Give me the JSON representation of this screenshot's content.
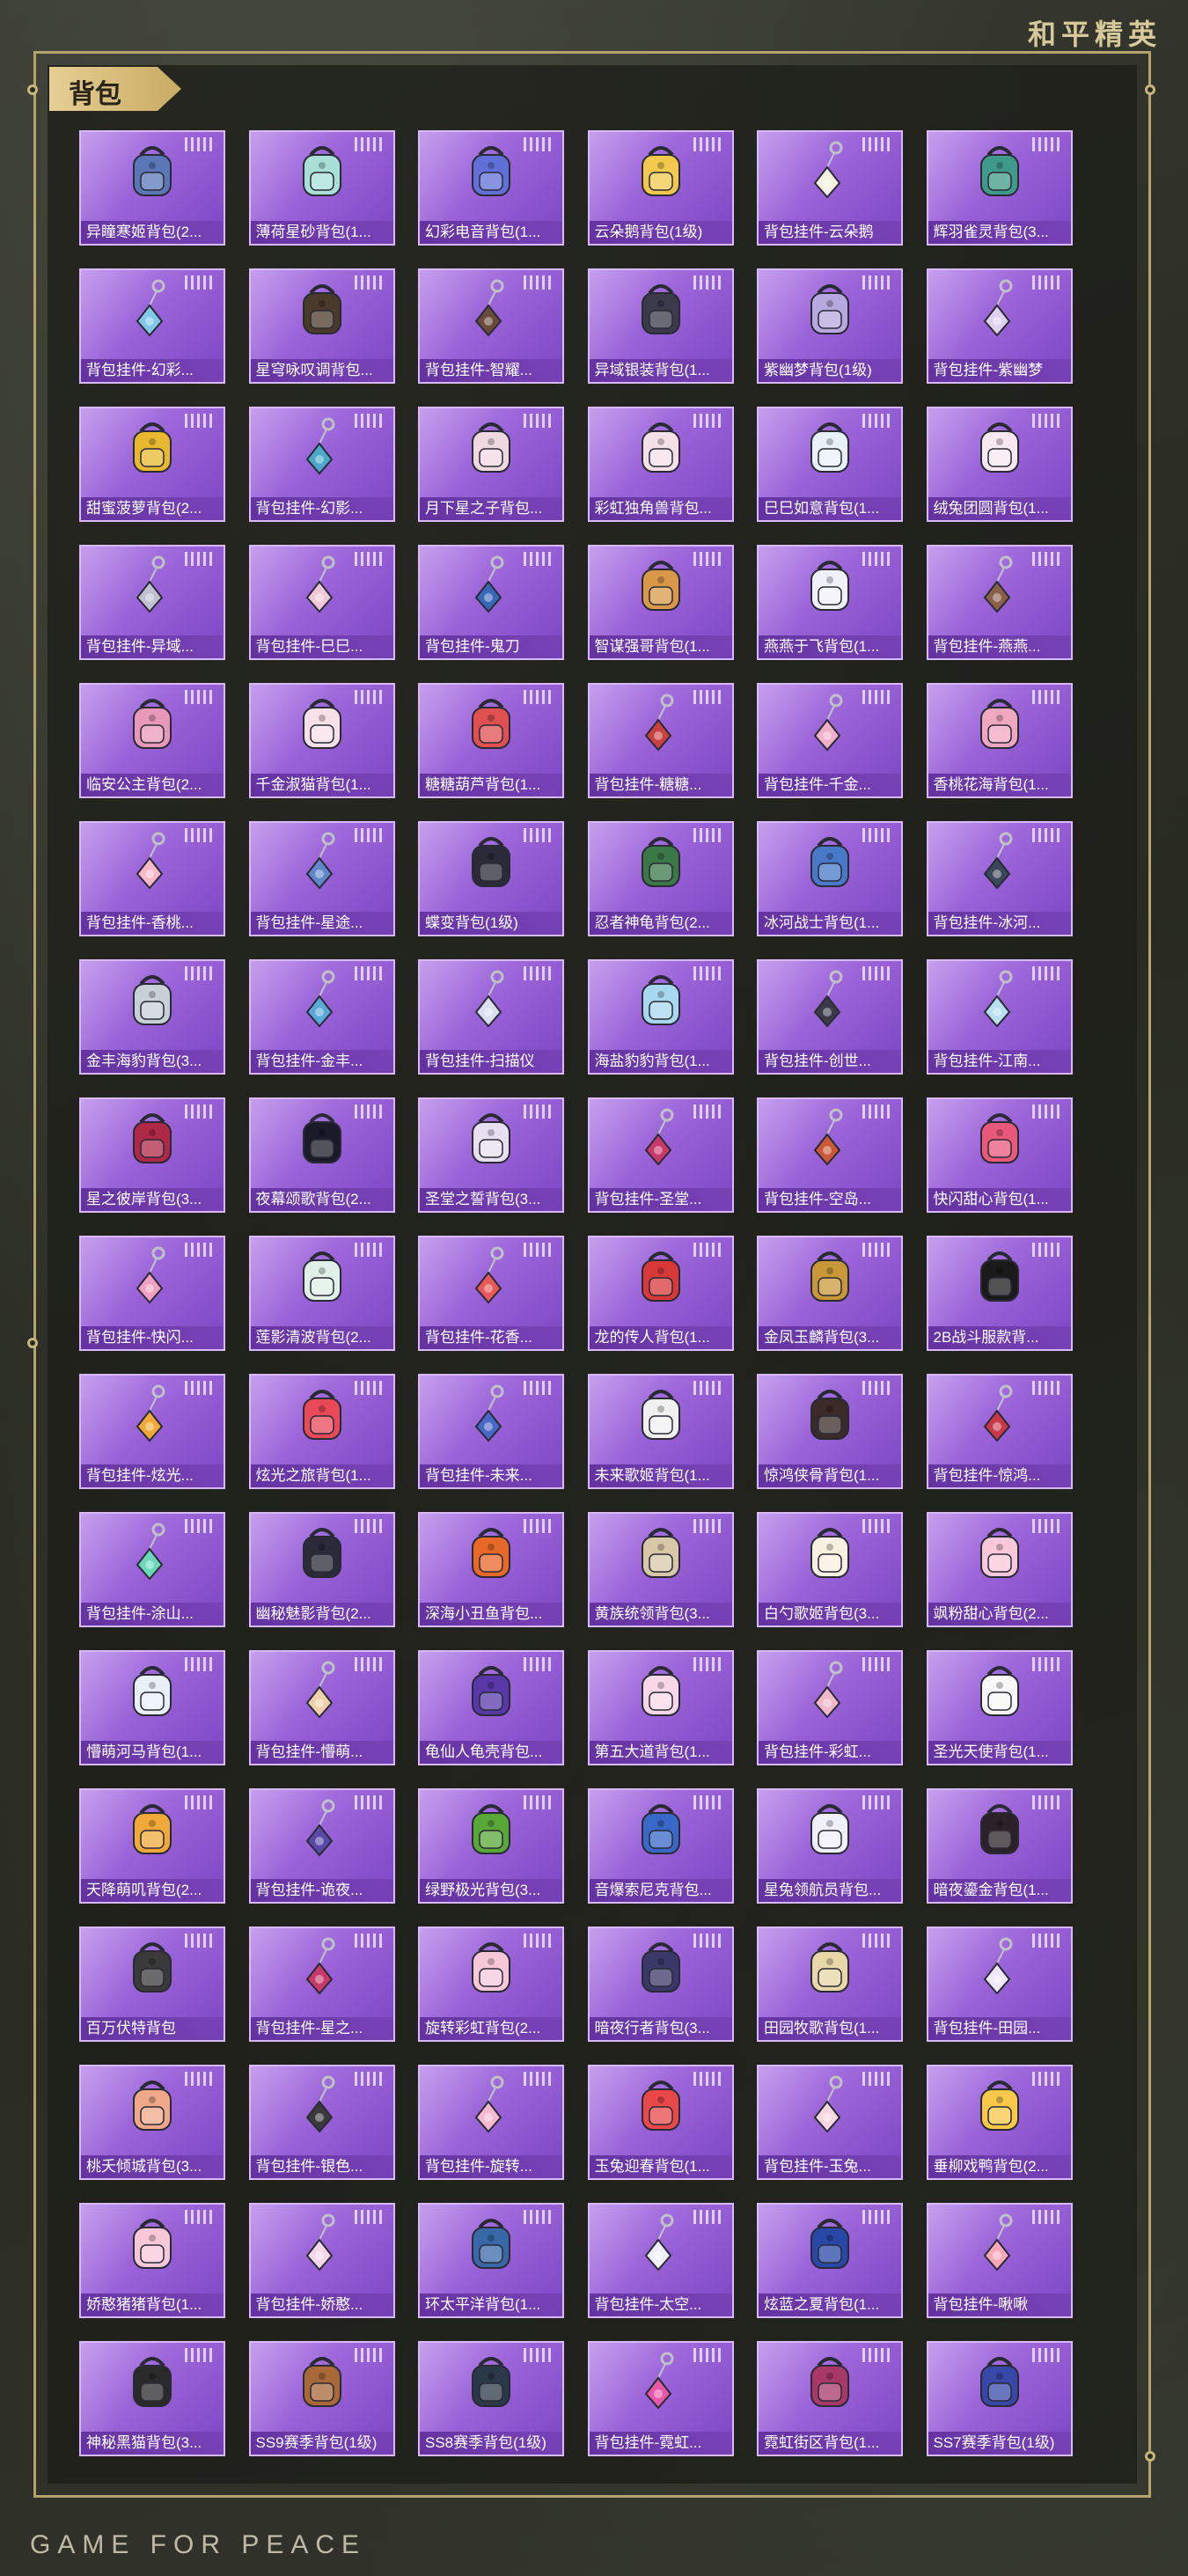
{
  "brand_top": "和平精英",
  "brand_bottom": "GAME FOR PEACE",
  "section": {
    "title": "背包"
  },
  "items": [
    {
      "name": "异瞳寒姬背包(2...",
      "icon": "backpack-icon",
      "color": "#5a78b8"
    },
    {
      "name": "薄荷星砂背包(1...",
      "icon": "backpack-icon",
      "color": "#a8e0d8"
    },
    {
      "name": "幻彩电音背包(1...",
      "icon": "backpack-icon",
      "color": "#6070d8"
    },
    {
      "name": "云朵鹅背包(1级)",
      "icon": "backpack-icon",
      "color": "#f2c94c"
    },
    {
      "name": "背包挂件-云朵鹅",
      "icon": "pendant-icon",
      "color": "#f5f0e0"
    },
    {
      "name": "辉羽雀灵背包(3...",
      "icon": "backpack-icon",
      "color": "#3f9a8a"
    },
    {
      "name": "背包挂件-幻彩...",
      "icon": "pendant-icon",
      "color": "#7fc8e8"
    },
    {
      "name": "星穹咏叹调背包...",
      "icon": "backpack-icon",
      "color": "#4a3a2a"
    },
    {
      "name": "背包挂件-智耀...",
      "icon": "pendant-icon",
      "color": "#6a4a3a"
    },
    {
      "name": "异域银装背包(1...",
      "icon": "backpack-icon",
      "color": "#3a3a4a"
    },
    {
      "name": "紫幽梦背包(1级)",
      "icon": "backpack-icon",
      "color": "#b8a8e0"
    },
    {
      "name": "背包挂件-紫幽梦",
      "icon": "pendant-icon",
      "color": "#e0d0f0"
    },
    {
      "name": "甜蜜菠萝背包(2...",
      "icon": "backpack-icon",
      "color": "#e8b830"
    },
    {
      "name": "背包挂件-幻影...",
      "icon": "pendant-icon",
      "color": "#4aa8c8"
    },
    {
      "name": "月下星之子背包...",
      "icon": "backpack-icon",
      "color": "#f0d8e0"
    },
    {
      "name": "彩虹独角兽背包...",
      "icon": "backpack-icon",
      "color": "#f5e0e8"
    },
    {
      "name": "巳巳如意背包(1...",
      "icon": "backpack-icon",
      "color": "#e8f0f8"
    },
    {
      "name": "绒兔团圆背包(1...",
      "icon": "backpack-icon",
      "color": "#f8e8f0"
    },
    {
      "name": "背包挂件-异域...",
      "icon": "pendant-icon",
      "color": "#c0c0d0"
    },
    {
      "name": "背包挂件-巳巳...",
      "icon": "pendant-icon",
      "color": "#f0c8d8"
    },
    {
      "name": "背包挂件-鬼刀",
      "icon": "pendant-icon",
      "color": "#3a68b8"
    },
    {
      "name": "智谋强哥背包(1...",
      "icon": "backpack-icon",
      "color": "#d89848"
    },
    {
      "name": "燕燕于飞背包(1...",
      "icon": "backpack-icon",
      "color": "#f0f0f8"
    },
    {
      "name": "背包挂件-燕燕...",
      "icon": "pendant-icon",
      "color": "#8a6048"
    },
    {
      "name": "临安公主背包(2...",
      "icon": "backpack-icon",
      "color": "#e898b8"
    },
    {
      "name": "千金淑猫背包(1...",
      "icon": "backpack-icon",
      "color": "#f8e0e8"
    },
    {
      "name": "糖糖葫芦背包(1...",
      "icon": "backpack-icon",
      "color": "#e05050"
    },
    {
      "name": "背包挂件-糖糖...",
      "icon": "pendant-icon",
      "color": "#c84040"
    },
    {
      "name": "背包挂件-千金...",
      "icon": "pendant-icon",
      "color": "#f0b0c8"
    },
    {
      "name": "香桃花海背包(1...",
      "icon": "backpack-icon",
      "color": "#f0a8c0"
    },
    {
      "name": "背包挂件-香桃...",
      "icon": "pendant-icon",
      "color": "#f8b8c8"
    },
    {
      "name": "背包挂件-星途...",
      "icon": "pendant-icon",
      "color": "#6088c8"
    },
    {
      "name": "蝶变背包(1级)",
      "icon": "backpack-icon",
      "color": "#2a2a38"
    },
    {
      "name": "忍者神龟背包(2...",
      "icon": "backpack-icon",
      "color": "#3a7848"
    },
    {
      "name": "冰河战士背包(1...",
      "icon": "backpack-icon",
      "color": "#4878c8"
    },
    {
      "name": "背包挂件-冰河...",
      "icon": "pendant-icon",
      "color": "#3a4858"
    },
    {
      "name": "金丰海豹背包(3...",
      "icon": "backpack-icon",
      "color": "#c8d0d8"
    },
    {
      "name": "背包挂件-金丰...",
      "icon": "pendant-icon",
      "color": "#58a8d8"
    },
    {
      "name": "背包挂件-扫描仪",
      "icon": "pendant-icon",
      "color": "#d8e0f0"
    },
    {
      "name": "海盐豹豹背包(1...",
      "icon": "backpack-icon",
      "color": "#a8d8f0"
    },
    {
      "name": "背包挂件-创世...",
      "icon": "pendant-icon",
      "color": "#3a3a48"
    },
    {
      "name": "背包挂件-江南...",
      "icon": "pendant-icon",
      "color": "#b8e0f0"
    },
    {
      "name": "星之彼岸背包(3...",
      "icon": "backpack-icon",
      "color": "#b02848"
    },
    {
      "name": "夜幕颂歌背包(2...",
      "icon": "backpack-icon",
      "color": "#1a1a28"
    },
    {
      "name": "圣堂之誓背包(3...",
      "icon": "backpack-icon",
      "color": "#e8e0f0"
    },
    {
      "name": "背包挂件-圣堂...",
      "icon": "pendant-icon",
      "color": "#c83868"
    },
    {
      "name": "背包挂件-空岛...",
      "icon": "pendant-icon",
      "color": "#c85838"
    },
    {
      "name": "快闪甜心背包(1...",
      "icon": "backpack-icon",
      "color": "#e85878"
    },
    {
      "name": "背包挂件-快闪...",
      "icon": "pendant-icon",
      "color": "#f0a0c0"
    },
    {
      "name": "莲影清波背包(2...",
      "icon": "backpack-icon",
      "color": "#e0f0e8"
    },
    {
      "name": "背包挂件-花香...",
      "icon": "pendant-icon",
      "color": "#e85858"
    },
    {
      "name": "龙的传人背包(1...",
      "icon": "backpack-icon",
      "color": "#d83838"
    },
    {
      "name": "金凤玉麟背包(3...",
      "icon": "backpack-icon",
      "color": "#c89838"
    },
    {
      "name": "2B战斗服款背...",
      "icon": "backpack-icon",
      "color": "#1a1a1a"
    },
    {
      "name": "背包挂件-炫光...",
      "icon": "pendant-icon",
      "color": "#f0a838"
    },
    {
      "name": "炫光之旅背包(1...",
      "icon": "backpack-icon",
      "color": "#e84858"
    },
    {
      "name": "背包挂件-未来...",
      "icon": "pendant-icon",
      "color": "#4868c8"
    },
    {
      "name": "未来歌姬背包(1...",
      "icon": "backpack-icon",
      "color": "#f0f0f0"
    },
    {
      "name": "惊鸿侠骨背包(1...",
      "icon": "backpack-icon",
      "color": "#3a2a28"
    },
    {
      "name": "背包挂件-惊鸿...",
      "icon": "pendant-icon",
      "color": "#c83848"
    },
    {
      "name": "背包挂件-涂山...",
      "icon": "pendant-icon",
      "color": "#68d8b8"
    },
    {
      "name": "幽秘魅影背包(2...",
      "icon": "backpack-icon",
      "color": "#2a2a38"
    },
    {
      "name": "深海小丑鱼背包...",
      "icon": "backpack-icon",
      "color": "#e86828"
    },
    {
      "name": "黄族统领背包(3...",
      "icon": "backpack-icon",
      "color": "#d8c8a8"
    },
    {
      "name": "白勺歌姬背包(3...",
      "icon": "backpack-icon",
      "color": "#f8f0e0"
    },
    {
      "name": "飒粉甜心背包(2...",
      "icon": "backpack-icon",
      "color": "#f8c8d8"
    },
    {
      "name": "懵萌河马背包(1...",
      "icon": "backpack-icon",
      "color": "#e8f0f8"
    },
    {
      "name": "背包挂件-懵萌...",
      "icon": "pendant-icon",
      "color": "#f0d0a8"
    },
    {
      "name": "龟仙人龟壳背包...",
      "icon": "backpack-icon",
      "color": "#5838a8"
    },
    {
      "name": "第五大道背包(1...",
      "icon": "backpack-icon",
      "color": "#f8d8e8"
    },
    {
      "name": "背包挂件-彩虹...",
      "icon": "pendant-icon",
      "color": "#f0b8c8"
    },
    {
      "name": "圣光天使背包(1...",
      "icon": "backpack-icon",
      "color": "#f8f8f8"
    },
    {
      "name": "天降萌叽背包(2...",
      "icon": "backpack-icon",
      "color": "#f0a838"
    },
    {
      "name": "背包挂件-诡夜...",
      "icon": "pendant-icon",
      "color": "#5848a8"
    },
    {
      "name": "绿野极光背包(3...",
      "icon": "backpack-icon",
      "color": "#58a838"
    },
    {
      "name": "音爆索尼克背包...",
      "icon": "backpack-icon",
      "color": "#3868c8"
    },
    {
      "name": "星兔领航员背包...",
      "icon": "backpack-icon",
      "color": "#f0f0f8"
    },
    {
      "name": "暗夜鎏金背包(1...",
      "icon": "backpack-icon",
      "color": "#2a2228"
    },
    {
      "name": "百万伏特背包",
      "icon": "backpack-icon",
      "color": "#3a3a3a"
    },
    {
      "name": "背包挂件-星之...",
      "icon": "pendant-icon",
      "color": "#c83868"
    },
    {
      "name": "旋转彩虹背包(2...",
      "icon": "backpack-icon",
      "color": "#f8c8d8"
    },
    {
      "name": "暗夜行者背包(3...",
      "icon": "backpack-icon",
      "color": "#3a3868"
    },
    {
      "name": "田园牧歌背包(1...",
      "icon": "backpack-icon",
      "color": "#e8d8a8"
    },
    {
      "name": "背包挂件-田园...",
      "icon": "pendant-icon",
      "color": "#f0e8f8"
    },
    {
      "name": "桃夭倾城背包(3...",
      "icon": "backpack-icon",
      "color": "#f0a888"
    },
    {
      "name": "背包挂件-银色...",
      "icon": "pendant-icon",
      "color": "#3a3a3a"
    },
    {
      "name": "背包挂件-旋转...",
      "icon": "pendant-icon",
      "color": "#f8b8d0"
    },
    {
      "name": "玉兔迎春背包(1...",
      "icon": "backpack-icon",
      "color": "#e84848"
    },
    {
      "name": "背包挂件-玉兔...",
      "icon": "pendant-icon",
      "color": "#f8d8e0"
    },
    {
      "name": "垂柳戏鸭背包(2...",
      "icon": "backpack-icon",
      "color": "#f8c848"
    },
    {
      "name": "娇憨猪猪背包(1...",
      "icon": "backpack-icon",
      "color": "#f8c8d8"
    },
    {
      "name": "背包挂件-娇憨...",
      "icon": "pendant-icon",
      "color": "#f8d8e8"
    },
    {
      "name": "环太平洋背包(1...",
      "icon": "backpack-icon",
      "color": "#3868a8"
    },
    {
      "name": "背包挂件-太空...",
      "icon": "pendant-icon",
      "color": "#f0f0f8"
    },
    {
      "name": "炫蓝之夏背包(1...",
      "icon": "backpack-icon",
      "color": "#2848a8"
    },
    {
      "name": "背包挂件-啾啾",
      "icon": "pendant-icon",
      "color": "#f8a8b8"
    },
    {
      "name": "神秘黑猫背包(3...",
      "icon": "backpack-icon",
      "color": "#2a2a2a"
    },
    {
      "name": "SS9赛季背包(1级)",
      "icon": "backpack-icon",
      "color": "#a86838"
    },
    {
      "name": "SS8赛季背包(1级)",
      "icon": "backpack-icon",
      "color": "#2a3848"
    },
    {
      "name": "背包挂件-霓虹...",
      "icon": "pendant-icon",
      "color": "#e858a8"
    },
    {
      "name": "霓虹街区背包(1...",
      "icon": "backpack-icon",
      "color": "#a83868"
    },
    {
      "name": "SS7赛季背包(1级)",
      "icon": "backpack-icon",
      "color": "#3848a8"
    }
  ]
}
